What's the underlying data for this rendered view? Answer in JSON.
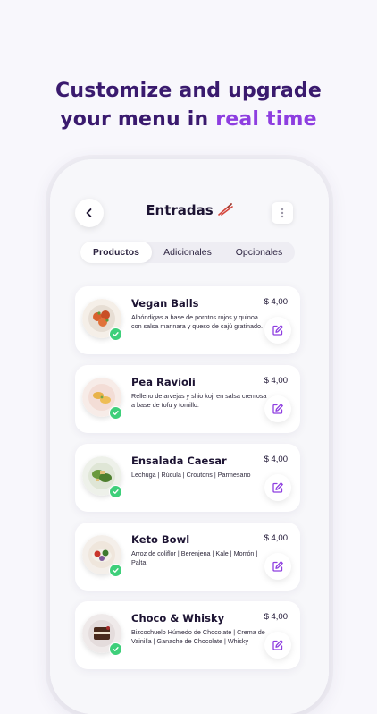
{
  "headline": {
    "line1": "Customize and upgrade",
    "line2_prefix": "your menu in ",
    "line2_accent": "real time"
  },
  "colors": {
    "accent": "#8e3ee0",
    "heading": "#3a1a6e",
    "check": "#3ecf7a",
    "icon": "#8e3ee0"
  },
  "screen": {
    "title": "Entradas",
    "title_icon": "chopsticks-icon",
    "tabs": [
      {
        "label": "Productos",
        "active": true
      },
      {
        "label": "Adicionales",
        "active": false
      },
      {
        "label": "Opcionales",
        "active": false
      }
    ],
    "products": [
      {
        "name": "Vegan Balls",
        "desc": "Albóndigas a base de porotos rojos y quinoa con salsa marinara y queso de cajú gratinado.",
        "price": "$ 4,00"
      },
      {
        "name": "Pea Ravioli",
        "desc": "Relleno de arvejas y shio koji en salsa cremosa a base de tofu y tomillo.",
        "price": "$ 4,00"
      },
      {
        "name": "Ensalada Caesar",
        "desc": "Lechuga | Rúcula | Croutons | Parmesano",
        "price": "$ 4,00"
      },
      {
        "name": "Keto Bowl",
        "desc": "Arroz de coliflor | Berenjena | Kale | Morrón | Palta",
        "price": "$ 4,00"
      },
      {
        "name": "Choco & Whisky",
        "desc": "Bizcochuelo Húmedo de Chocolate | Crema de Vainilla | Ganache de Chocolate | Whisky",
        "price": "$ 4,00"
      }
    ]
  }
}
